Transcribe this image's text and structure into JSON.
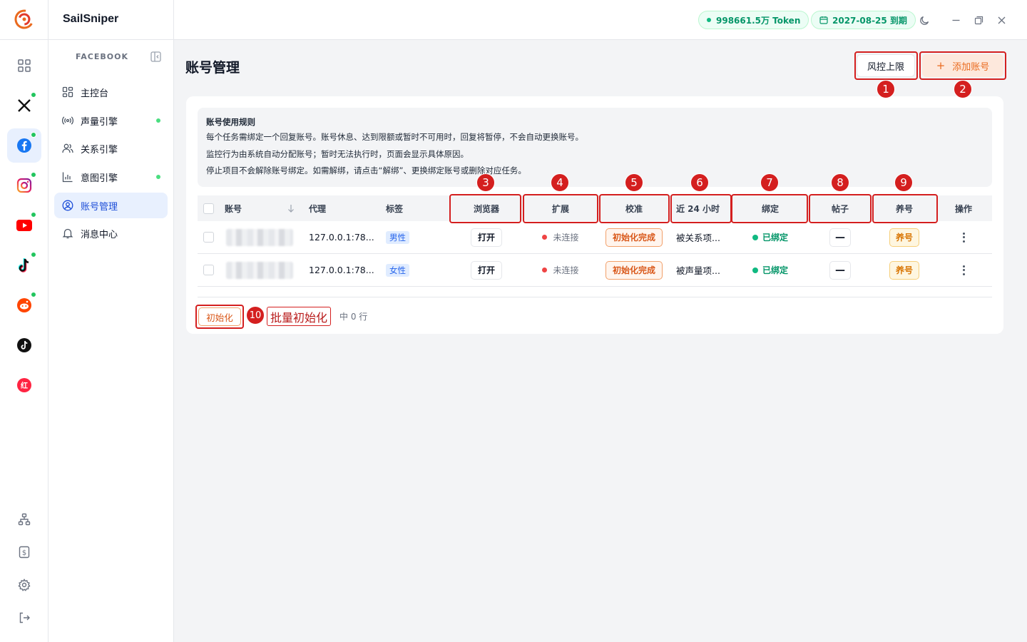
{
  "app": {
    "name": "SailSniper"
  },
  "topbar": {
    "token": "998661.5万 Token",
    "expiry": "2027-08-25 到期"
  },
  "sidebar": {
    "section": "FACEBOOK",
    "items": [
      {
        "label": "主控台"
      },
      {
        "label": "声量引擎"
      },
      {
        "label": "关系引擎"
      },
      {
        "label": "意图引擎"
      },
      {
        "label": "账号管理"
      },
      {
        "label": "消息中心"
      }
    ]
  },
  "page": {
    "title": "账号管理",
    "risk_button": "风控上限",
    "add_button": "添加账号"
  },
  "rules": {
    "title": "账号使用规则",
    "lines": [
      "每个任务需绑定一个回复账号。账号休息、达到限额或暂时不可用时，回复将暂停，不会自动更换账号。",
      "监控行为由系统自动分配账号；暂时无法执行时，页面会显示具体原因。",
      "停止项目不会解除账号绑定。如需解绑，请点击“解绑”、更换绑定账号或删除对应任务。"
    ]
  },
  "table": {
    "headers": {
      "account": "账号",
      "proxy": "代理",
      "tag": "标签",
      "browser": "浏览器",
      "extension": "扩展",
      "calibration": "校准",
      "last24": "近 24 小时",
      "binding": "绑定",
      "posts": "帖子",
      "nurture": "养号",
      "actions": "操作"
    },
    "rows": [
      {
        "proxy": "127.0.0.1:78...",
        "tag": "男性",
        "browser": "打开",
        "extension": "未连接",
        "calibration": "初始化完成",
        "last24": "被关系项...",
        "binding": "已绑定",
        "posts": "—",
        "nurture": "养号"
      },
      {
        "proxy": "127.0.0.1:78...",
        "tag": "女性",
        "browser": "打开",
        "extension": "未连接",
        "calibration": "初始化完成",
        "last24": "被声量项...",
        "binding": "已绑定",
        "posts": "—",
        "nurture": "养号"
      }
    ]
  },
  "footer": {
    "init_button": "初始化",
    "selected_suffix": "中 0 行"
  },
  "annotations": {
    "numbers": [
      "1",
      "2",
      "3",
      "4",
      "5",
      "6",
      "7",
      "8",
      "9",
      "10"
    ],
    "label_10": "批量初始化"
  },
  "colors": {
    "accent_orange": "#ea6a1e",
    "annotation_red": "#d41f1f",
    "status_green": "#10b981"
  }
}
